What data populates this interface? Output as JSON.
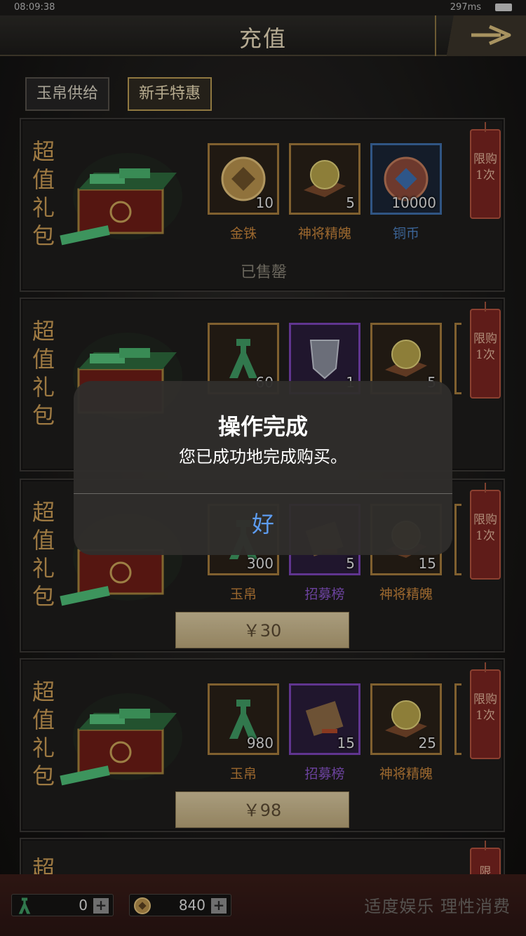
{
  "status_bar": {
    "time": "08:09:38",
    "network": "297ms"
  },
  "header": {
    "title": "充值"
  },
  "tabs": [
    {
      "label": "玉帛供给",
      "active": false
    },
    {
      "label": "新手特惠",
      "active": true
    }
  ],
  "packages": [
    {
      "title": "超值礼包",
      "limit": "限购1次",
      "items": [
        {
          "name": "金铢",
          "qty": "10",
          "rarity": "gold",
          "icon": "coin-icon"
        },
        {
          "name": "神将精魄",
          "qty": "5",
          "rarity": "gold",
          "icon": "orb-icon"
        },
        {
          "name": "铜币",
          "qty": "10000",
          "rarity": "blue",
          "icon": "copper-coin-icon"
        }
      ],
      "status": "已售罄"
    },
    {
      "title": "超值礼包",
      "limit": "限购1次",
      "items": [
        {
          "name": "玉帛",
          "qty": "60",
          "rarity": "gold",
          "icon": "jade-icon"
        },
        {
          "name": "",
          "qty": "1",
          "rarity": "purple",
          "icon": "token-icon"
        },
        {
          "name": "",
          "qty": "5",
          "rarity": "gold",
          "icon": "orb-icon"
        }
      ]
    },
    {
      "title": "超值礼包",
      "limit": "限购1次",
      "items": [
        {
          "name": "玉帛",
          "qty": "300",
          "rarity": "gold",
          "icon": "jade-icon"
        },
        {
          "name": "招募榜",
          "qty": "5",
          "rarity": "purple",
          "icon": "scroll-icon"
        },
        {
          "name": "神将精魄",
          "qty": "15",
          "rarity": "gold",
          "icon": "orb-icon"
        }
      ],
      "price": "￥30"
    },
    {
      "title": "超值礼包",
      "limit": "限购1次",
      "items": [
        {
          "name": "玉帛",
          "qty": "980",
          "rarity": "gold",
          "icon": "jade-icon"
        },
        {
          "name": "招募榜",
          "qty": "15",
          "rarity": "purple",
          "icon": "scroll-icon"
        },
        {
          "name": "神将精魄",
          "qty": "25",
          "rarity": "gold",
          "icon": "orb-icon"
        }
      ],
      "price": "￥98"
    },
    {
      "title": "超",
      "limit": "限"
    }
  ],
  "dialog": {
    "title": "操作完成",
    "message": "您已成功地完成购买。",
    "ok_label": "好"
  },
  "bottom_bar": {
    "jade_amount": "0",
    "coin_amount": "840",
    "slogan": "适度娱乐 理性消费"
  },
  "colors": {
    "gold_border": "#a57b3d",
    "purple_border": "#7b44b8",
    "blue_border": "#3e6ea8",
    "dialog_button": "#5d9cf0"
  }
}
